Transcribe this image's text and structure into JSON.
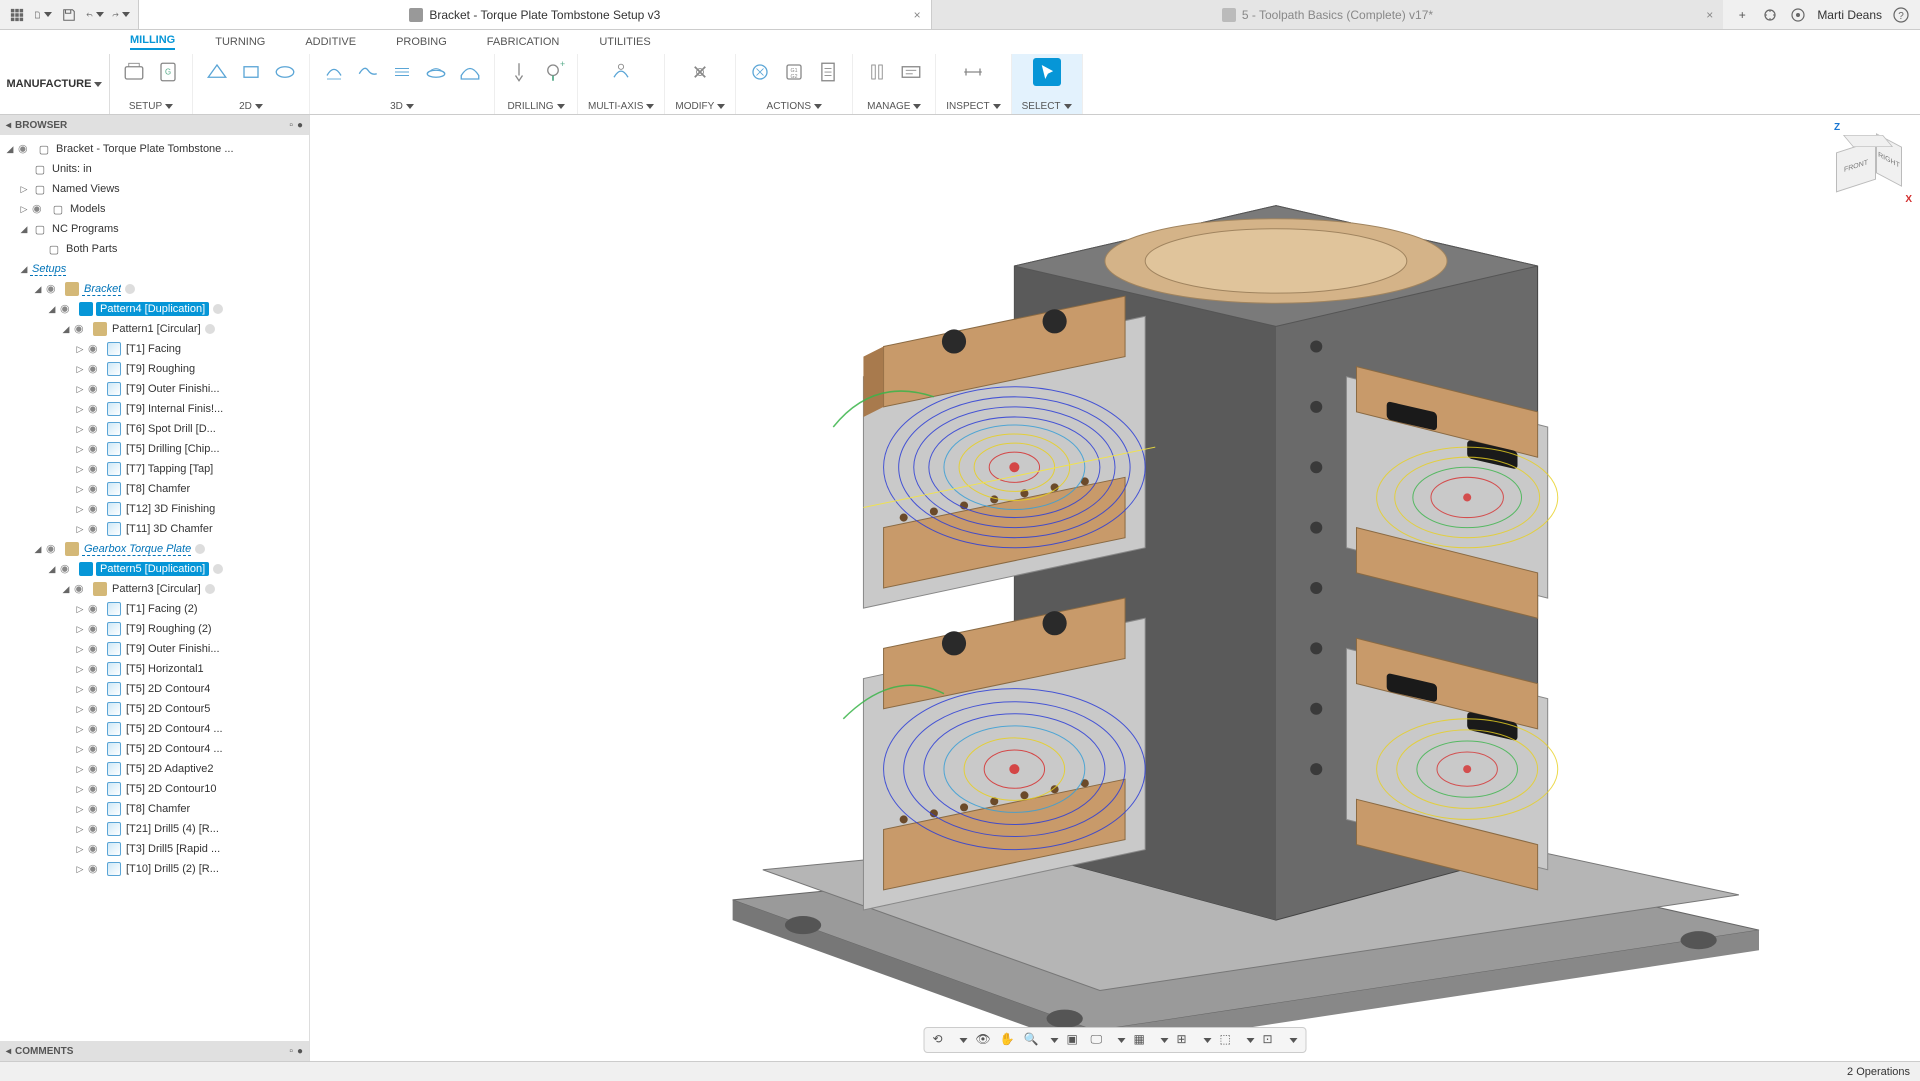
{
  "titlebar": {
    "tab1": "Bracket - Torque Plate Tombstone Setup v3",
    "tab2": "5 - Toolpath Basics (Complete) v17*",
    "user": "Marti Deans"
  },
  "workspace": "MANUFACTURE",
  "ribbon_tabs": [
    "MILLING",
    "TURNING",
    "ADDITIVE",
    "PROBING",
    "FABRICATION",
    "UTILITIES"
  ],
  "ribbon_groups": {
    "setup": "SETUP",
    "g2d": "2D",
    "g3d": "3D",
    "drilling": "DRILLING",
    "multiaxis": "MULTI-AXIS",
    "modify": "MODIFY",
    "actions": "ACTIONS",
    "manage": "MANAGE",
    "inspect": "INSPECT",
    "select": "SELECT"
  },
  "panels": {
    "browser": "BROWSER",
    "comments": "COMMENTS"
  },
  "tree": {
    "root": "Bracket - Torque Plate Tombstone ...",
    "units": "Units: in",
    "named_views": "Named Views",
    "models": "Models",
    "nc_programs": "NC Programs",
    "both_parts": "Both Parts",
    "setups": "Setups",
    "bracket": "Bracket",
    "pattern4": "Pattern4 [Duplication]",
    "pattern1": "Pattern1 [Circular]",
    "ops1": [
      "[T1] Facing",
      "[T9] Roughing",
      "[T9] Outer Finishi...",
      "[T9] Internal Finis!...",
      "[T6] Spot Drill [D...",
      "[T5] Drilling [Chip...",
      "[T7] Tapping [Tap]",
      "[T8] Chamfer",
      "[T12] 3D Finishing",
      "[T11] 3D Chamfer"
    ],
    "gearbox": "Gearbox Torque Plate",
    "pattern5": "Pattern5 [Duplication]",
    "pattern3": "Pattern3 [Circular]",
    "ops2": [
      "[T1] Facing (2)",
      "[T9] Roughing (2)",
      "[T9] Outer Finishi...",
      "[T5] Horizontal1",
      "[T5] 2D Contour4",
      "[T5] 2D Contour5",
      "[T5] 2D Contour4 ...",
      "[T5] 2D Contour4 ...",
      "[T5] 2D Adaptive2",
      "[T5] 2D Contour10",
      "[T8] Chamfer",
      "[T21] Drill5 (4) [R...",
      "[T3] Drill5 [Rapid ...",
      "[T10] Drill5 (2) [R..."
    ]
  },
  "status": {
    "operations": "2 Operations"
  },
  "viewcube": {
    "front": "FRONT",
    "right": "RIGHT",
    "z": "Z",
    "x": "X"
  }
}
